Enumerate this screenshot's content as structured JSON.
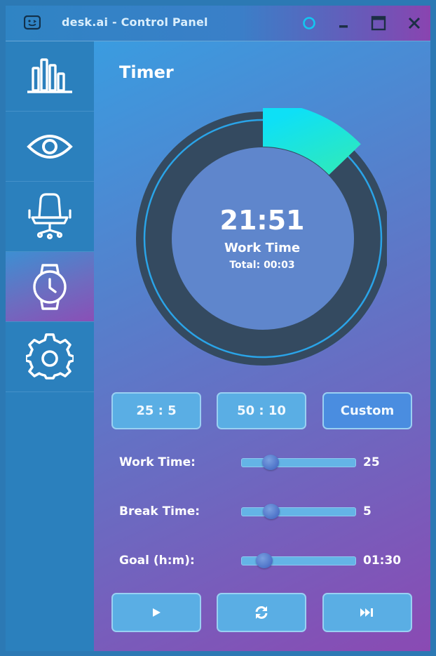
{
  "window": {
    "title": "desk.ai - Control Panel",
    "icons": [
      "app-logo-icon",
      "circle-icon",
      "minimize-icon",
      "maximize-icon",
      "close-icon"
    ]
  },
  "sidebar": {
    "items": [
      {
        "icon": "bar-chart-icon",
        "active": false
      },
      {
        "icon": "eye-icon",
        "active": false
      },
      {
        "icon": "office-chair-icon",
        "active": false
      },
      {
        "icon": "smartwatch-clock-icon",
        "active": true
      },
      {
        "icon": "gear-icon",
        "active": false
      }
    ]
  },
  "main": {
    "title": "Timer",
    "timer": {
      "time": "21:51",
      "mode": "Work Time",
      "total": "Total: 00:03",
      "progress": 0.128,
      "goal_progress": 0.035
    },
    "presets": [
      "25 : 5",
      "50 : 10",
      "Custom"
    ],
    "sliders": [
      {
        "label": "Work Time:",
        "value": "25",
        "fraction": 0.25
      },
      {
        "label": "Break Time:",
        "value": "5",
        "fraction": 0.26
      },
      {
        "label": "Goal (h:m):",
        "value": "01:30",
        "fraction": 0.2
      }
    ],
    "controls": [
      "play-icon",
      "refresh-icon",
      "skip-forward-icon"
    ]
  },
  "colors": {
    "ring_track": "#344a60",
    "progress_start": "#0ee0f6",
    "progress_end": "#2ae8c4",
    "goal_arc": "#8a4ab3",
    "accent_blue": "#4a8de0",
    "button_fill": "#5aaee4"
  }
}
